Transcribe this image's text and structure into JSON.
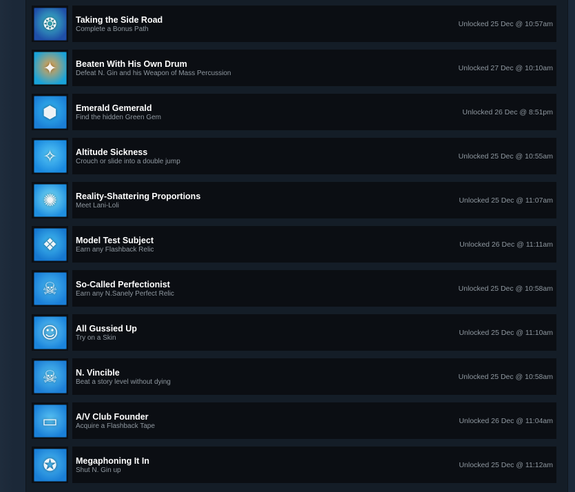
{
  "achievements": [
    {
      "title": "Taking the Side Road",
      "description": "Complete a Bonus Path",
      "unlocked": "Unlocked 25 Dec @ 10:57am",
      "icon": "side-road-icon",
      "color_a": "#1f4fa8",
      "color_b": "#3fc2c9",
      "glyph": "❂"
    },
    {
      "title": "Beaten With His Own Drum",
      "description": "Defeat N. Gin and his Weapon of Mass Percussion",
      "unlocked": "Unlocked 27 Dec @ 10:10am",
      "icon": "drum-icon",
      "color_a": "#1aa3d9",
      "color_b": "#f0a347",
      "glyph": "✦"
    },
    {
      "title": "Emerald Gemerald",
      "description": "Find the hidden Green Gem",
      "unlocked": "Unlocked 26 Dec @ 8:51pm",
      "icon": "green-gem-icon",
      "color_a": "#1b7fd6",
      "color_b": "#35b8f0",
      "glyph": "⬢"
    },
    {
      "title": "Altitude Sickness",
      "description": "Crouch or slide into a double jump",
      "unlocked": "Unlocked 25 Dec @ 10:55am",
      "icon": "double-jump-icon",
      "color_a": "#1a8ae0",
      "color_b": "#58c8f5",
      "glyph": "✧"
    },
    {
      "title": "Reality-Shattering Proportions",
      "description": "Meet Lani-Loli",
      "unlocked": "Unlocked 25 Dec @ 11:07am",
      "icon": "lani-loli-icon",
      "color_a": "#1f8fe0",
      "color_b": "#7fe0f5",
      "glyph": "✺"
    },
    {
      "title": "Model Test Subject",
      "description": "Earn any Flashback Relic",
      "unlocked": "Unlocked 26 Dec @ 11:11am",
      "icon": "flashback-relic-icon",
      "color_a": "#1678d0",
      "color_b": "#45bff2",
      "glyph": "❖"
    },
    {
      "title": "So-Called Perfectionist",
      "description": "Earn any N.Sanely Perfect Relic",
      "unlocked": "Unlocked 25 Dec @ 10:58am",
      "icon": "perfect-relic-icon",
      "color_a": "#1a7fd8",
      "color_b": "#4ab8ef",
      "glyph": "☠"
    },
    {
      "title": "All Gussied Up",
      "description": "Try on a Skin",
      "unlocked": "Unlocked 25 Dec @ 11:10am",
      "icon": "skin-icon",
      "color_a": "#1b85dc",
      "color_b": "#62c6f3",
      "glyph": "☺"
    },
    {
      "title": "N. Vincible",
      "description": "Beat a story level without dying",
      "unlocked": "Unlocked 25 Dec @ 10:58am",
      "icon": "skull-icon",
      "color_a": "#1d7fd6",
      "color_b": "#53c1f1",
      "glyph": "☠"
    },
    {
      "title": "A/V Club Founder",
      "description": "Acquire a Flashback Tape",
      "unlocked": "Unlocked 26 Dec @ 11:04am",
      "icon": "flashback-tape-icon",
      "color_a": "#1a80d8",
      "color_b": "#5ac4f3",
      "glyph": "▭"
    },
    {
      "title": "Megaphoning It In",
      "description": "Shut N. Gin up",
      "unlocked": "Unlocked 25 Dec @ 11:12am",
      "icon": "megaphone-icon",
      "color_a": "#1a7fd6",
      "color_b": "#4cbaf0",
      "glyph": "✪"
    }
  ]
}
